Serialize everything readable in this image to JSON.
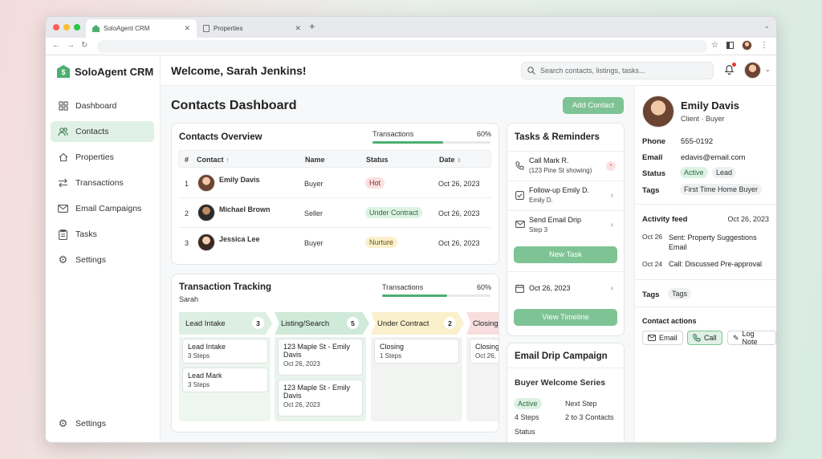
{
  "browser": {
    "tabs": [
      {
        "label": "SoloAgent CRM",
        "active": true
      },
      {
        "label": "Properties",
        "active": false
      }
    ],
    "new_tab": "+",
    "nav": {
      "back": "←",
      "forward": "→",
      "reload": "↻"
    },
    "chevron": "⌄"
  },
  "brand": {
    "name": "SoloAgent CRM",
    "icon": "house-icon",
    "color": "#4caf6f"
  },
  "sidebar": {
    "items": [
      {
        "label": "Dashboard",
        "icon": "grid-icon"
      },
      {
        "label": "Contacts",
        "icon": "people-icon",
        "active": true
      },
      {
        "label": "Properties",
        "icon": "house-icon"
      },
      {
        "label": "Transactions",
        "icon": "arrows-icon"
      },
      {
        "label": "Email Campaigns",
        "icon": "mail-icon"
      },
      {
        "label": "Tasks",
        "icon": "clipboard-icon"
      },
      {
        "label": "Settings",
        "icon": "gear-icon"
      }
    ],
    "footer_settings": "Settings"
  },
  "header": {
    "welcome": "Welcome, Sarah Jenkins!",
    "search_placeholder": "Search contacts, listings, tasks..."
  },
  "main": {
    "title": "Contacts Dashboard",
    "add_contact": "Add Contact",
    "contacts_overview": {
      "title": "Contacts Overview",
      "progress_label": "Transactions",
      "progress_value": "60%",
      "progress_fraction": 0.6,
      "columns": [
        "#",
        "Contact",
        "Name",
        "Status",
        "Date"
      ],
      "sort_arrow": "↑",
      "rows": [
        {
          "num": "1",
          "contact": "Emily Davis",
          "name": "Buyer",
          "status": "Hot",
          "status_kind": "red",
          "date": "Oct 26, 2023"
        },
        {
          "num": "2",
          "contact": "Michael Brown",
          "name": "Seller",
          "status": "Under Contract",
          "status_kind": "green",
          "date": "Oct 26, 2023"
        },
        {
          "num": "3",
          "contact": "Jessica Lee",
          "name": "Buyer",
          "status": "Nurture",
          "status_kind": "yellow",
          "date": "Oct 26, 2023"
        }
      ]
    },
    "transaction_tracking": {
      "title": "Transaction Tracking",
      "subtitle": "Sarah",
      "progress_label": "Transactions",
      "progress_value": "60%",
      "progress_fraction": 0.6,
      "stages": [
        {
          "name": "Lead Intake",
          "count": "3",
          "color": "#dcefe2",
          "deals": [
            {
              "title": "Lead Intake",
              "sub": "3 Steps"
            },
            {
              "title": "Lead Mark",
              "sub": "3 Steps"
            }
          ]
        },
        {
          "name": "Listing/Search",
          "count": "5",
          "color": "#cfead8",
          "deals": [
            {
              "title": "123 Maple St - Emily Davis",
              "sub": "Oct 26, 2023"
            },
            {
              "title": "123 Maple St - Emily Davis",
              "sub": "Oct 26, 2023"
            }
          ]
        },
        {
          "name": "Under Contract",
          "count": "2",
          "color": "#fbf0cc",
          "deals": [
            {
              "title": "Closing",
              "sub": "1 Steps"
            }
          ]
        },
        {
          "name": "Closing",
          "count": "",
          "color": "#f8dede",
          "deals": [
            {
              "title": "Closing",
              "sub": "Oct 26,"
            }
          ]
        }
      ]
    }
  },
  "tasks": {
    "title": "Tasks & Reminders",
    "items": [
      {
        "icon": "phone-icon",
        "title": "Call Mark R.",
        "sub": "(123 Pine St showing)"
      },
      {
        "icon": "check-icon",
        "title": "Follow-up Emily D.",
        "sub": "Emily D."
      },
      {
        "icon": "mail-icon",
        "title": "Send Email Drip",
        "sub": "Step 3"
      }
    ],
    "new_task": "New Task",
    "date": "Oct 26, 2023",
    "view_timeline": "View Timeline"
  },
  "drip": {
    "title": "Email Drip Campaign",
    "series": "Buyer Welcome Series",
    "status_badge": "Active",
    "steps": "4 Steps",
    "next_step_label": "Next Step",
    "next_step_value": "2 to 3 Contacts",
    "status_label": "Status"
  },
  "contact_panel": {
    "name": "Emily Davis",
    "role": "Client · Buyer",
    "fields": {
      "phone_label": "Phone",
      "phone": "555-0192",
      "email_label": "Email",
      "email": "edavis@email.com",
      "status_label": "Status",
      "status_badges": [
        "Active",
        "Lead"
      ],
      "tags_label": "Tags",
      "tags": [
        "First Time Home Buyer"
      ]
    },
    "activity": {
      "title": "Activity feed",
      "date": "Oct 26, 2023",
      "items": [
        {
          "date": "Oct 26",
          "text": "Sent: Property Suggestions Email"
        },
        {
          "date": "Oct 24",
          "text": "Call: Discussed Pre-approval"
        }
      ]
    },
    "tags_section": {
      "label": "Tags",
      "tag": "Tags"
    },
    "actions": {
      "title": "Contact actions",
      "email": "Email",
      "call": "Call",
      "log_note": "Log Note"
    }
  }
}
